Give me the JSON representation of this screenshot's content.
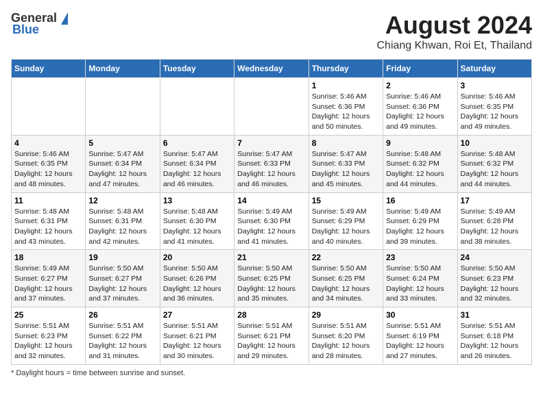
{
  "header": {
    "logo_general": "General",
    "logo_blue": "Blue",
    "title": "August 2024",
    "subtitle": "Chiang Khwan, Roi Et, Thailand"
  },
  "footer": {
    "note": "Daylight hours"
  },
  "columns": [
    "Sunday",
    "Monday",
    "Tuesday",
    "Wednesday",
    "Thursday",
    "Friday",
    "Saturday"
  ],
  "weeks": [
    [
      {
        "day": "",
        "info": ""
      },
      {
        "day": "",
        "info": ""
      },
      {
        "day": "",
        "info": ""
      },
      {
        "day": "",
        "info": ""
      },
      {
        "day": "1",
        "info": "Sunrise: 5:46 AM\nSunset: 6:36 PM\nDaylight: 12 hours\nand 50 minutes."
      },
      {
        "day": "2",
        "info": "Sunrise: 5:46 AM\nSunset: 6:36 PM\nDaylight: 12 hours\nand 49 minutes."
      },
      {
        "day": "3",
        "info": "Sunrise: 5:46 AM\nSunset: 6:35 PM\nDaylight: 12 hours\nand 49 minutes."
      }
    ],
    [
      {
        "day": "4",
        "info": "Sunrise: 5:46 AM\nSunset: 6:35 PM\nDaylight: 12 hours\nand 48 minutes."
      },
      {
        "day": "5",
        "info": "Sunrise: 5:47 AM\nSunset: 6:34 PM\nDaylight: 12 hours\nand 47 minutes."
      },
      {
        "day": "6",
        "info": "Sunrise: 5:47 AM\nSunset: 6:34 PM\nDaylight: 12 hours\nand 46 minutes."
      },
      {
        "day": "7",
        "info": "Sunrise: 5:47 AM\nSunset: 6:33 PM\nDaylight: 12 hours\nand 46 minutes."
      },
      {
        "day": "8",
        "info": "Sunrise: 5:47 AM\nSunset: 6:33 PM\nDaylight: 12 hours\nand 45 minutes."
      },
      {
        "day": "9",
        "info": "Sunrise: 5:48 AM\nSunset: 6:32 PM\nDaylight: 12 hours\nand 44 minutes."
      },
      {
        "day": "10",
        "info": "Sunrise: 5:48 AM\nSunset: 6:32 PM\nDaylight: 12 hours\nand 44 minutes."
      }
    ],
    [
      {
        "day": "11",
        "info": "Sunrise: 5:48 AM\nSunset: 6:31 PM\nDaylight: 12 hours\nand 43 minutes."
      },
      {
        "day": "12",
        "info": "Sunrise: 5:48 AM\nSunset: 6:31 PM\nDaylight: 12 hours\nand 42 minutes."
      },
      {
        "day": "13",
        "info": "Sunrise: 5:48 AM\nSunset: 6:30 PM\nDaylight: 12 hours\nand 41 minutes."
      },
      {
        "day": "14",
        "info": "Sunrise: 5:49 AM\nSunset: 6:30 PM\nDaylight: 12 hours\nand 41 minutes."
      },
      {
        "day": "15",
        "info": "Sunrise: 5:49 AM\nSunset: 6:29 PM\nDaylight: 12 hours\nand 40 minutes."
      },
      {
        "day": "16",
        "info": "Sunrise: 5:49 AM\nSunset: 6:29 PM\nDaylight: 12 hours\nand 39 minutes."
      },
      {
        "day": "17",
        "info": "Sunrise: 5:49 AM\nSunset: 6:28 PM\nDaylight: 12 hours\nand 38 minutes."
      }
    ],
    [
      {
        "day": "18",
        "info": "Sunrise: 5:49 AM\nSunset: 6:27 PM\nDaylight: 12 hours\nand 37 minutes."
      },
      {
        "day": "19",
        "info": "Sunrise: 5:50 AM\nSunset: 6:27 PM\nDaylight: 12 hours\nand 37 minutes."
      },
      {
        "day": "20",
        "info": "Sunrise: 5:50 AM\nSunset: 6:26 PM\nDaylight: 12 hours\nand 36 minutes."
      },
      {
        "day": "21",
        "info": "Sunrise: 5:50 AM\nSunset: 6:25 PM\nDaylight: 12 hours\nand 35 minutes."
      },
      {
        "day": "22",
        "info": "Sunrise: 5:50 AM\nSunset: 6:25 PM\nDaylight: 12 hours\nand 34 minutes."
      },
      {
        "day": "23",
        "info": "Sunrise: 5:50 AM\nSunset: 6:24 PM\nDaylight: 12 hours\nand 33 minutes."
      },
      {
        "day": "24",
        "info": "Sunrise: 5:50 AM\nSunset: 6:23 PM\nDaylight: 12 hours\nand 32 minutes."
      }
    ],
    [
      {
        "day": "25",
        "info": "Sunrise: 5:51 AM\nSunset: 6:23 PM\nDaylight: 12 hours\nand 32 minutes."
      },
      {
        "day": "26",
        "info": "Sunrise: 5:51 AM\nSunset: 6:22 PM\nDaylight: 12 hours\nand 31 minutes."
      },
      {
        "day": "27",
        "info": "Sunrise: 5:51 AM\nSunset: 6:21 PM\nDaylight: 12 hours\nand 30 minutes."
      },
      {
        "day": "28",
        "info": "Sunrise: 5:51 AM\nSunset: 6:21 PM\nDaylight: 12 hours\nand 29 minutes."
      },
      {
        "day": "29",
        "info": "Sunrise: 5:51 AM\nSunset: 6:20 PM\nDaylight: 12 hours\nand 28 minutes."
      },
      {
        "day": "30",
        "info": "Sunrise: 5:51 AM\nSunset: 6:19 PM\nDaylight: 12 hours\nand 27 minutes."
      },
      {
        "day": "31",
        "info": "Sunrise: 5:51 AM\nSunset: 6:18 PM\nDaylight: 12 hours\nand 26 minutes."
      }
    ]
  ]
}
